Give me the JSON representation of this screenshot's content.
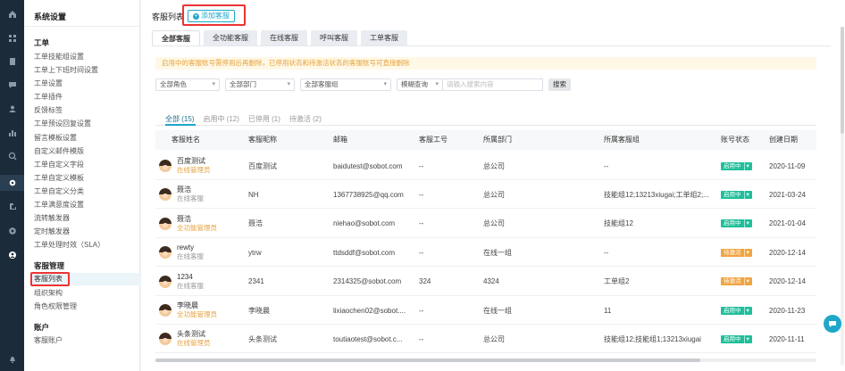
{
  "sidebar": {
    "title": "系统设置",
    "groups": [
      {
        "label": "工单",
        "items": [
          "工单技能组设置",
          "工单上下班时间设置",
          "工单设置",
          "工单插件",
          "反馈标签",
          "工单预设回复设置",
          "留言模板设置",
          "自定义邮件模版",
          "工单自定义字段",
          "工单自定义模板",
          "工单自定义分类",
          "工单满意度设置",
          "流转触发器",
          "定时触发器",
          "工单处理时效（SLA）"
        ]
      },
      {
        "label": "客服管理",
        "items": [
          "客服列表",
          "组织架构",
          "角色权限管理"
        ]
      },
      {
        "label": "账户",
        "items": [
          "客服账户"
        ]
      }
    ]
  },
  "main": {
    "page_title": "客服列表",
    "add_button": "添加客服",
    "tabs": [
      "全部客服",
      "全功能客服",
      "在线客服",
      "呼叫客服",
      "工单客服"
    ],
    "notice": "启用中的客服账号需停用后再删除，已停用状态和待激活状态的客服账号可直接删除",
    "filters": {
      "role": "全部角色",
      "dept": "全部部门",
      "group": "全部客服组",
      "mode": "模糊查询",
      "search_placeholder": "请输入搜索内容",
      "search_button": "搜索"
    },
    "status_tabs": [
      "全部 (15)",
      "启用中 (12)",
      "已停用 (1)",
      "待激活 (2)"
    ],
    "columns": [
      "客服姓名",
      "客服昵称",
      "邮箱",
      "客服工号",
      "所属部门",
      "所属客服组",
      "账号状态",
      "创建日期"
    ],
    "rows": [
      {
        "name": "百度测试",
        "role": "在线管理员",
        "role_type": "orange",
        "nick": "百度测试",
        "email": "baidutest@sobot.com",
        "no": "--",
        "dept": "总公司",
        "group": "--",
        "status": "启用中",
        "status_type": "on",
        "date": "2020-11-09"
      },
      {
        "name": "聂浩",
        "role": "在线客服",
        "role_type": "gray",
        "nick": "NH",
        "email": "1367738925@qq.com",
        "no": "--",
        "dept": "总公司",
        "group": "技能组12;13213xiugai;工单组2;...",
        "status": "启用中",
        "status_type": "on",
        "date": "2021-03-24"
      },
      {
        "name": "聂浩",
        "role": "全功能管理员",
        "role_type": "orange",
        "nick": "聂浩",
        "email": "niehao@sobot.com",
        "no": "--",
        "dept": "总公司",
        "group": "技能组12",
        "status": "启用中",
        "status_type": "on",
        "date": "2021-01-04"
      },
      {
        "name": "rewty",
        "role": "在线客服",
        "role_type": "gray",
        "nick": "ytrw",
        "email": "ttdsddf@sobot.com",
        "no": "--",
        "dept": "在线一组",
        "group": "--",
        "status": "待激活",
        "status_type": "pending",
        "date": "2020-12-14"
      },
      {
        "name": "1234",
        "role": "在线客服",
        "role_type": "gray",
        "nick": "2341",
        "email": "2314325@sobot.com",
        "no": "324",
        "dept": "4324",
        "group": "工单组2",
        "status": "待激活",
        "status_type": "pending",
        "date": "2020-12-14"
      },
      {
        "name": "李晓晨",
        "role": "全功能管理员",
        "role_type": "orange",
        "nick": "李晓晨",
        "email": "lixiaochen02@sobot....",
        "no": "--",
        "dept": "在线一组",
        "group": "11",
        "status": "启用中",
        "status_type": "on",
        "date": "2020-11-23"
      },
      {
        "name": "头条测试",
        "role": "在线管理员",
        "role_type": "orange",
        "nick": "头条测试",
        "email": "toutiaotest@sobot.c...",
        "no": "--",
        "dept": "总公司",
        "group": "技能组12;技能组1;13213xiugai",
        "status": "启用中",
        "status_type": "on",
        "date": "2020-11-11"
      }
    ]
  },
  "colors": {
    "accent": "#1fa7c9",
    "orange": "#e6a23c",
    "green": "#1fbf9a",
    "pending": "#f0a541",
    "rail": "#1b2b3a"
  },
  "rail_icons": [
    "home-icon",
    "grid-icon",
    "document-icon",
    "message-icon",
    "user-icon",
    "stats-icon",
    "search-icon",
    "settings-icon",
    "export-icon",
    "globe-icon",
    "account-icon",
    "bell-icon"
  ]
}
